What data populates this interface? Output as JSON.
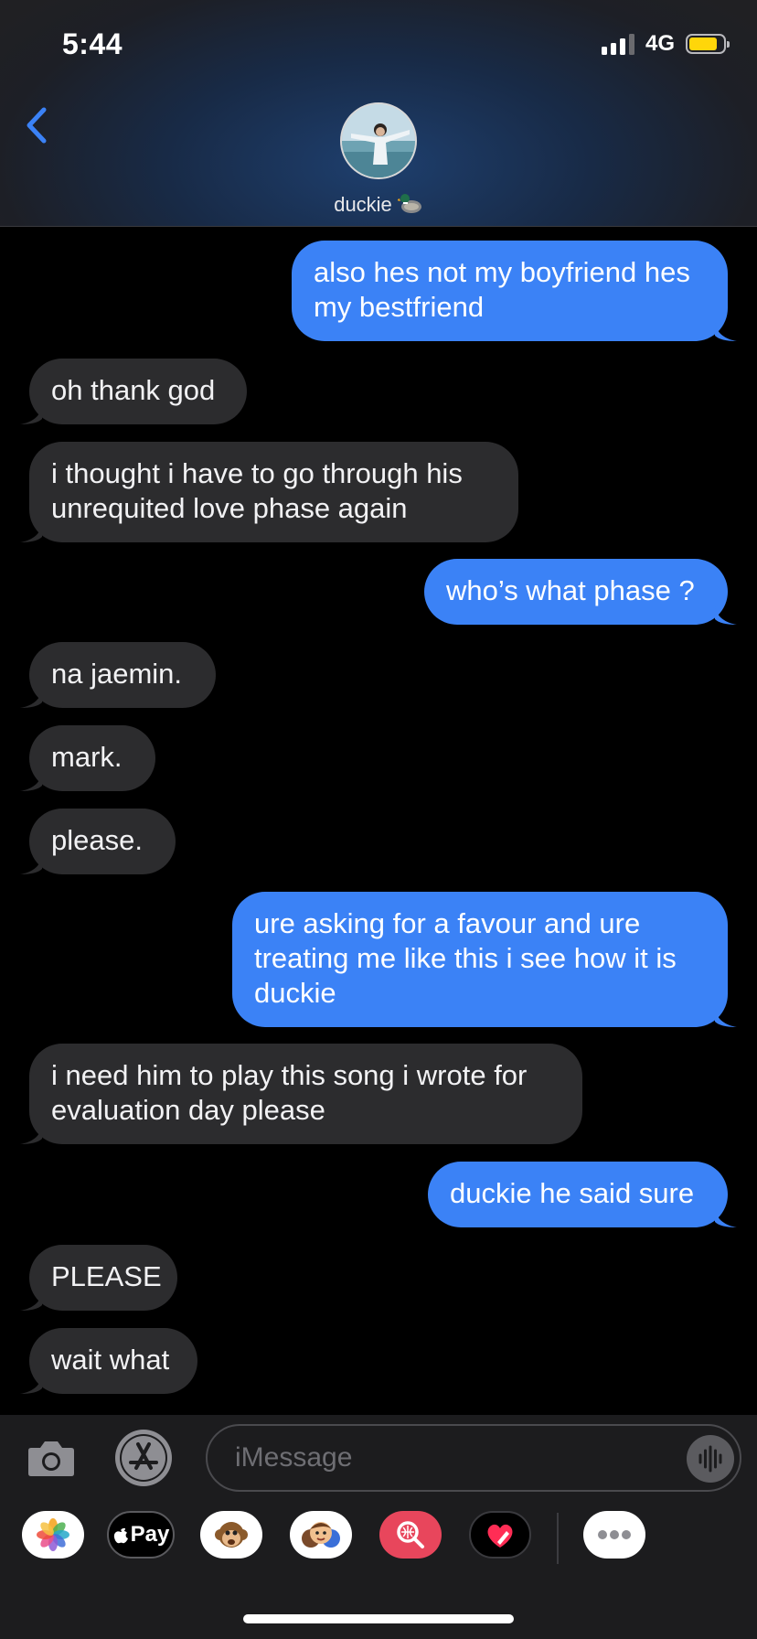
{
  "status_bar": {
    "time": "5:44",
    "network": "4G"
  },
  "header": {
    "contact_name": "duckie"
  },
  "messages": [
    {
      "from": "me",
      "text": "also hes not my boyfriend hes my bestfriend"
    },
    {
      "from": "them",
      "text": "oh thank god"
    },
    {
      "from": "them",
      "text": "i thought i have to go through his unrequited love phase again"
    },
    {
      "from": "me",
      "text": "who’s what phase ?"
    },
    {
      "from": "them",
      "text": "na jaemin."
    },
    {
      "from": "them",
      "text": "mark."
    },
    {
      "from": "them",
      "text": "please."
    },
    {
      "from": "me",
      "text": "ure asking for a favour and ure treating me like this i see how it is duckie"
    },
    {
      "from": "them",
      "text": "i need him to play this song i wrote for evaluation day please"
    },
    {
      "from": "me",
      "text": "duckie he said sure"
    },
    {
      "from": "them",
      "text": "PLEASE"
    },
    {
      "from": "them",
      "text": "wait what"
    }
  ],
  "input": {
    "placeholder": "iMessage"
  },
  "app_drawer": {
    "apple_pay_label": "Pay",
    "icons": [
      "photos-icon",
      "apple-pay-icon",
      "animoji-monkey-icon",
      "memoji-icon",
      "image-search-icon",
      "digital-touch-heart-icon",
      "more-icon"
    ]
  },
  "colors": {
    "sent_bubble": "#3b82f6",
    "received_bubble": "#2c2c2e",
    "battery": "#ffd60a",
    "accent": "#3b82f6"
  }
}
